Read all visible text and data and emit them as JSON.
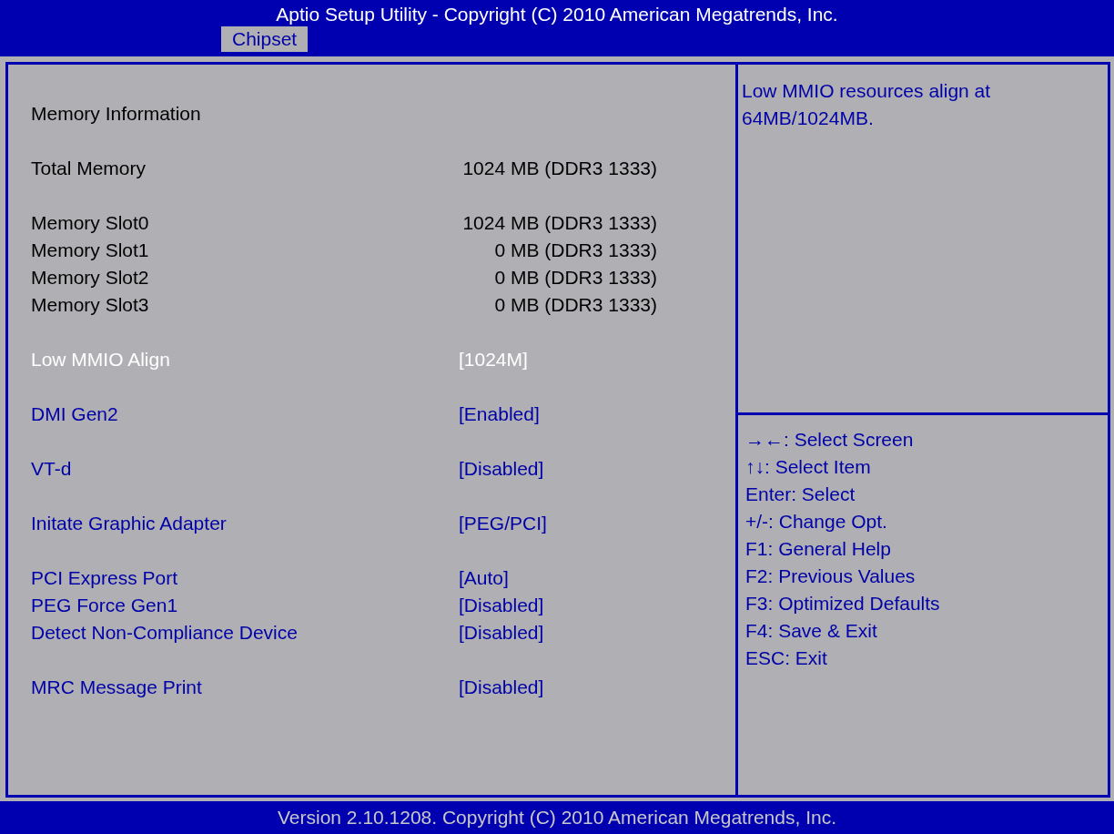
{
  "header": {
    "title": "Aptio Setup Utility - Copyright (C) 2010 American Megatrends, Inc."
  },
  "tabs": [
    {
      "label": "Chipset",
      "selected": true
    }
  ],
  "groups": [
    {
      "rows": [
        {
          "kind": "heading",
          "label": "Memory Information"
        }
      ]
    },
    {
      "rows": [
        {
          "kind": "info",
          "label": "Total Memory",
          "value": "1024 MB (DDR3 1333)"
        }
      ]
    },
    {
      "rows": [
        {
          "kind": "info",
          "label": "Memory Slot0",
          "value": "1024 MB (DDR3 1333)"
        },
        {
          "kind": "info",
          "label": "Memory Slot1",
          "value": "0 MB (DDR3 1333)"
        },
        {
          "kind": "info",
          "label": "Memory Slot2",
          "value": "0 MB (DDR3 1333)"
        },
        {
          "kind": "info",
          "label": "Memory Slot3",
          "value": "0 MB (DDR3 1333)"
        }
      ]
    },
    {
      "rows": [
        {
          "kind": "setting",
          "label": "Low MMIO Align",
          "value": "[1024M]",
          "selected": true
        }
      ]
    },
    {
      "rows": [
        {
          "kind": "setting",
          "label": "DMI Gen2",
          "value": "[Enabled]",
          "selected": false
        }
      ]
    },
    {
      "rows": [
        {
          "kind": "setting",
          "label": "VT-d",
          "value": "[Disabled]",
          "selected": false
        }
      ]
    },
    {
      "rows": [
        {
          "kind": "setting",
          "label": "Initate Graphic Adapter",
          "value": "[PEG/PCI]",
          "selected": false
        }
      ]
    },
    {
      "rows": [
        {
          "kind": "setting",
          "label": "PCI Express Port",
          "value": "[Auto]",
          "selected": false
        },
        {
          "kind": "setting",
          "label": "PEG Force Gen1",
          "value": "[Disabled]",
          "selected": false
        },
        {
          "kind": "setting",
          "label": "Detect Non-Compliance Device",
          "value": "[Disabled]",
          "selected": false
        }
      ]
    },
    {
      "rows": [
        {
          "kind": "setting",
          "label": "MRC Message Print",
          "value": "[Disabled]",
          "selected": false
        }
      ]
    }
  ],
  "help": {
    "text": "Low MMIO resources align at 64MB/1024MB."
  },
  "keys": [
    "→←: Select Screen",
    "↑↓: Select Item",
    "Enter: Select",
    "+/-: Change Opt.",
    "F1: General Help",
    "F2: Previous Values",
    "F3: Optimized Defaults",
    "F4: Save & Exit",
    "ESC: Exit"
  ],
  "footer": {
    "text": "Version 2.10.1208. Copyright (C) 2010 American Megatrends, Inc."
  }
}
